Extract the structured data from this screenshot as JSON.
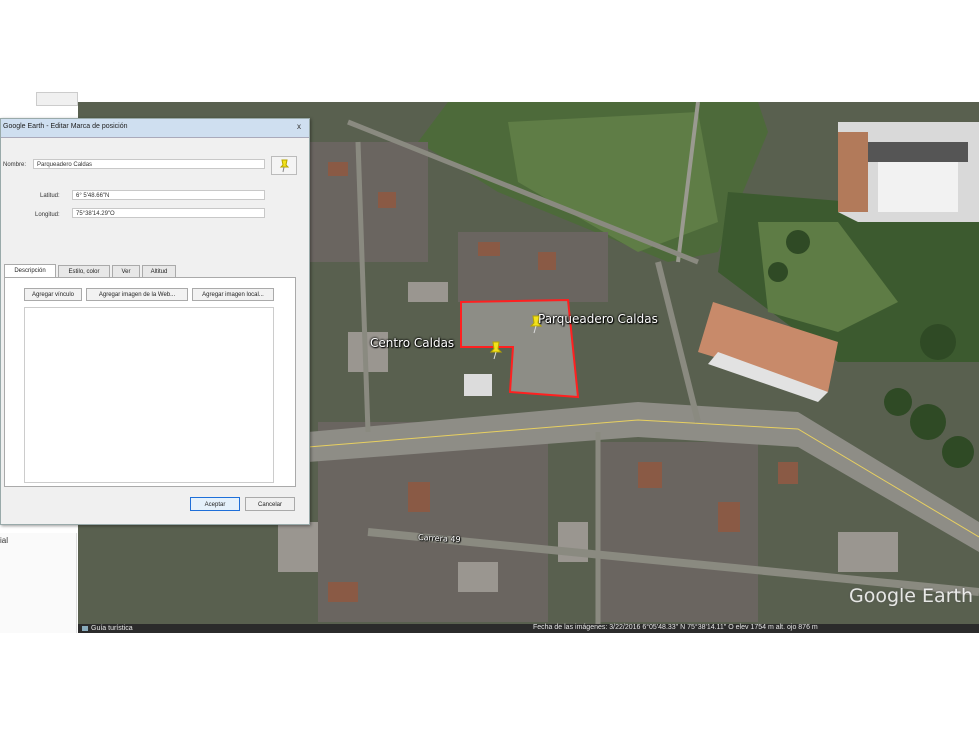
{
  "dialog": {
    "title": "Google Earth - Editar Marca de posición",
    "close_label": "x",
    "name_label": "Nombre:",
    "name_value": "Parqueadero Caldas",
    "lat_label": "Latitud:",
    "lat_value": "6° 5'48.66\"N",
    "lon_label": "Longitud:",
    "lon_value": "75°38'14.29\"O",
    "tabs": [
      {
        "label": "Descripción"
      },
      {
        "label": "Estilo, color"
      },
      {
        "label": "Ver"
      },
      {
        "label": "Altitud"
      }
    ],
    "buttons": {
      "add_link": "Agregar vínculo",
      "add_web_image": "Agregar imagen de la Web...",
      "add_local_image": "Agregar imagen local...",
      "accept": "Aceptar",
      "cancel": "Cancelar"
    }
  },
  "map": {
    "labels": {
      "parking": "Parqueadero Caldas",
      "center": "Centro Caldas",
      "street": "Carrera 49"
    },
    "logo": "Google Earth",
    "attribution": "Fecha de las imágenes: 3/22/2016   6°05'48.33\" N  75°38'14.11\" O  elev 1754 m  alt. ojo 876 m"
  },
  "statusbar": {
    "tour": "Guía turística"
  },
  "colors": {
    "accent": "#1e6fd9",
    "boundary": "#ff2020",
    "pin": "#f2e21b"
  },
  "icons": [
    "pushpin-icon",
    "close-icon",
    "tour-icon"
  ]
}
